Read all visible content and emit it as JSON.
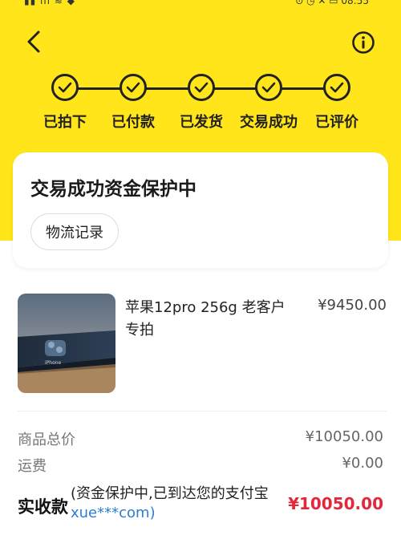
{
  "header": {
    "back_icon": "chevron-left-icon",
    "info_icon": "info-icon"
  },
  "steps": [
    {
      "label": "已拍下",
      "done": true
    },
    {
      "label": "已付款",
      "done": true
    },
    {
      "label": "已发货",
      "done": true
    },
    {
      "label": "交易成功",
      "done": true
    },
    {
      "label": "已评价",
      "done": true
    }
  ],
  "status_card": {
    "title": "交易成功资金保护中",
    "logistics_label": "物流记录"
  },
  "product": {
    "title": "苹果12pro 256g  老客户专拍",
    "price": "¥9450.00"
  },
  "summary": {
    "subtotal_label": "商品总价",
    "subtotal_value": "¥10050.00",
    "shipping_label": "运费",
    "shipping_value": "¥0.00",
    "total_label": "实收款",
    "total_note": "(资金保护中,已到达您的支付宝",
    "total_account": "xue***com)",
    "total_value": "¥10050.00"
  },
  "colors": {
    "accent": "#ffe51a",
    "price_red": "#e4273a",
    "link_blue": "#2a7fd4"
  }
}
